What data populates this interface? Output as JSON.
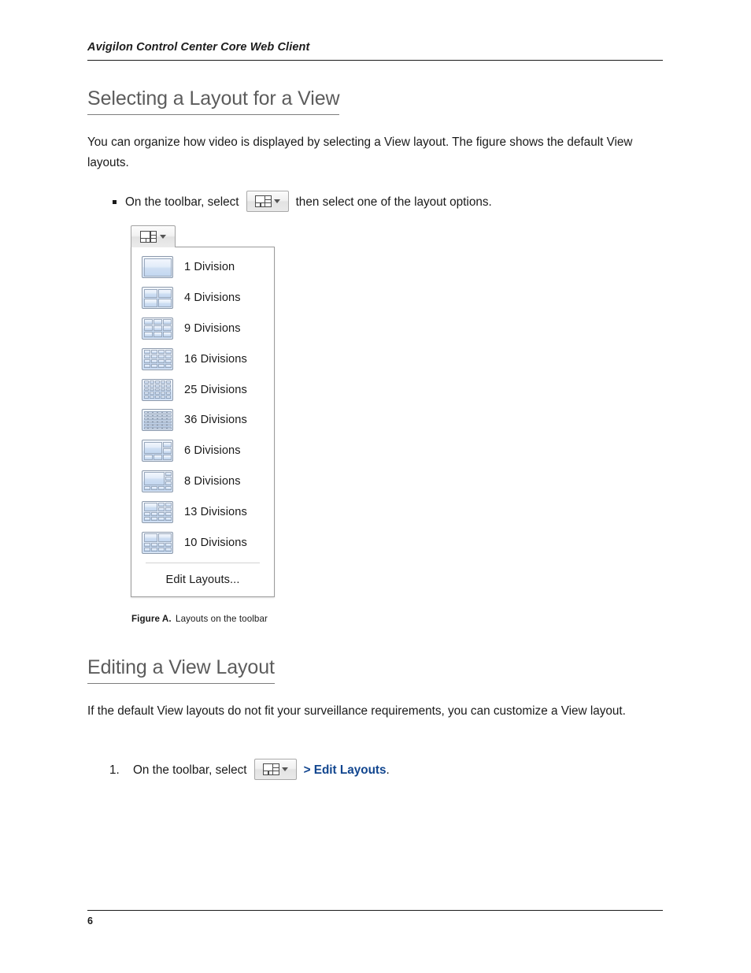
{
  "document": {
    "running_header": "Avigilon Control Center Core Web Client",
    "page_number": "6"
  },
  "sections": {
    "selecting": {
      "heading": "Selecting a Layout for a View",
      "paragraph": "You can organize how video is displayed by selecting a View layout. The figure shows the default View layouts.",
      "bullet": {
        "marker": "▪",
        "text_before": "On the toolbar, select",
        "text_after": "then select one of the layout options."
      }
    },
    "editing": {
      "heading": "Editing a View Layout",
      "paragraph": "If the default View layouts do not fit your surveillance requirements, you can customize a View layout.",
      "step": {
        "marker": "1.",
        "text_before": "On the toolbar, select",
        "link_text": "> Edit Layouts",
        "text_after": "."
      }
    }
  },
  "figure": {
    "caption_label": "Figure A.",
    "caption_text": "Layouts on the toolbar",
    "toolbar_button": {
      "icon": "layout-grid-icon",
      "caret": "chevron-down-icon"
    },
    "menu": {
      "items": [
        {
          "label": "1 Division",
          "thumb": "layout-1",
          "divisions": 1
        },
        {
          "label": "4 Divisions",
          "thumb": "layout-4",
          "divisions": 4
        },
        {
          "label": "9 Divisions",
          "thumb": "layout-9",
          "divisions": 9
        },
        {
          "label": "16 Divisions",
          "thumb": "layout-16",
          "divisions": 16
        },
        {
          "label": "25 Divisions",
          "thumb": "layout-25",
          "divisions": 25
        },
        {
          "label": "36 Divisions",
          "thumb": "layout-36",
          "divisions": 36
        },
        {
          "label": "6 Divisions",
          "thumb": "layout-6",
          "divisions": 6
        },
        {
          "label": "8 Divisions",
          "thumb": "layout-8",
          "divisions": 8
        },
        {
          "label": "13 Divisions",
          "thumb": "layout-13",
          "divisions": 13
        },
        {
          "label": "10 Divisions",
          "thumb": "layout-10",
          "divisions": 10
        }
      ],
      "edit_label": "Edit Layouts..."
    }
  },
  "colors": {
    "link_blue": "#12468f",
    "heading_gray": "#5c5c5c",
    "rule_black": "#1a1a1a",
    "thumb_blue": "#c3d7f0"
  }
}
